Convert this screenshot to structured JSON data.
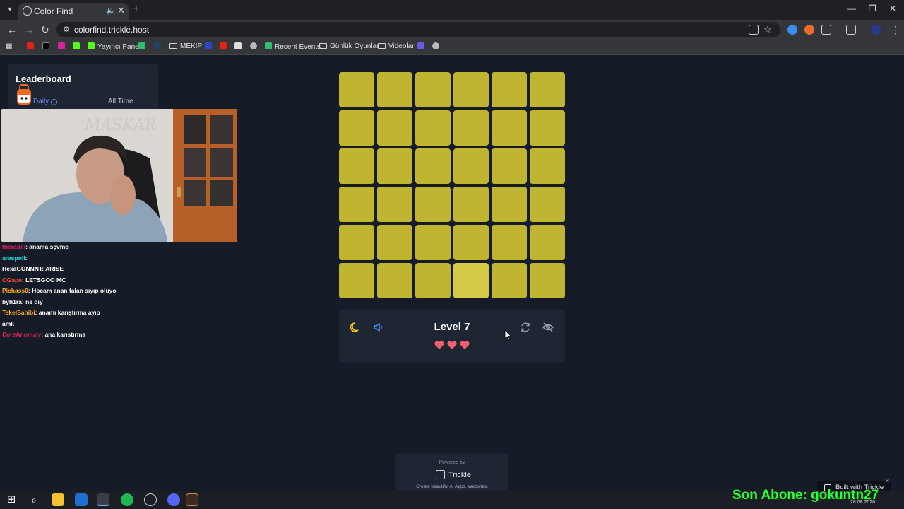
{
  "browser": {
    "tab_title": "Color Find",
    "url": "colorfind.trickle.host",
    "bookmarks": [
      "Yayıncı Paneli",
      "MEKİP",
      "Recent Events",
      "Günlük Oyunlar",
      "Videolar"
    ]
  },
  "leaderboard": {
    "title": "Leaderboard",
    "tab_daily": "Daily",
    "tab_alltime": "All Time"
  },
  "chat": [
    {
      "user": "theradel",
      "message": ": anama sçvme",
      "user_color": "#e0245e"
    },
    {
      "user": "araspoll",
      "message": ": ",
      "user_color": "#1ee0e0"
    },
    {
      "user": "HexaGONNNT",
      "message": ": ARISE",
      "user_color": "#ffffff"
    },
    {
      "user": "OGape",
      "message": ": LETSGOO MC",
      "user_color": "#ff4a2a"
    },
    {
      "user": "Pichass0",
      "message": ": Hocam anan falan sıyıp oluyo",
      "user_color": "#ffb020"
    },
    {
      "user": "byh1ra",
      "message": ": ne diy",
      "user_color": "#ffffff"
    },
    {
      "user": "TekelSahibi",
      "message": ": anamı karıştırma ayıp",
      "user_color": "#ffb020"
    },
    {
      "user": "",
      "message": "amk",
      "user_color": "#ffffff"
    },
    {
      "user": "CoreAnomaly",
      "message": ": ana karıstırma",
      "user_color": "#e0245e"
    }
  ],
  "game": {
    "level_label": "Level 7",
    "lives": 3,
    "grid_size": 6,
    "base_color": "#bfb530",
    "odd_color": "#d4ca45",
    "odd_cell": 33
  },
  "footer": {
    "powered_by": "Powered by",
    "brand": "Trickle",
    "description": "Create beautiful AI Apps, Websites,",
    "built_with": "Built with Trickle"
  },
  "overlay": {
    "text": "Son Abone: gokuntn27"
  },
  "taskbar": {
    "date": "28.08.2026"
  }
}
